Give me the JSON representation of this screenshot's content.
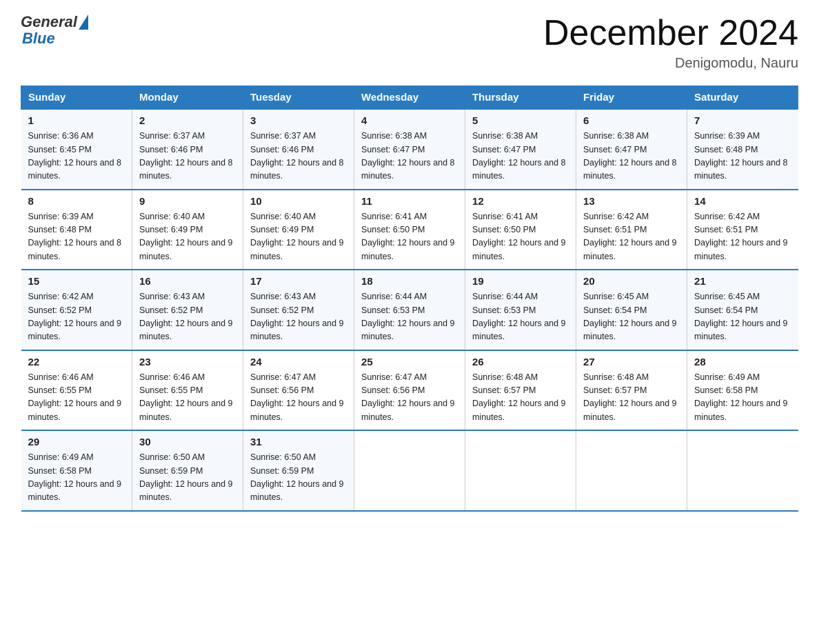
{
  "header": {
    "logo_general": "General",
    "logo_blue": "Blue",
    "month_year": "December 2024",
    "location": "Denigomodu, Nauru"
  },
  "columns": [
    "Sunday",
    "Monday",
    "Tuesday",
    "Wednesday",
    "Thursday",
    "Friday",
    "Saturday"
  ],
  "weeks": [
    [
      {
        "day": "1",
        "sunrise": "6:36 AM",
        "sunset": "6:45 PM",
        "daylight": "12 hours and 8 minutes."
      },
      {
        "day": "2",
        "sunrise": "6:37 AM",
        "sunset": "6:46 PM",
        "daylight": "12 hours and 8 minutes."
      },
      {
        "day": "3",
        "sunrise": "6:37 AM",
        "sunset": "6:46 PM",
        "daylight": "12 hours and 8 minutes."
      },
      {
        "day": "4",
        "sunrise": "6:38 AM",
        "sunset": "6:47 PM",
        "daylight": "12 hours and 8 minutes."
      },
      {
        "day": "5",
        "sunrise": "6:38 AM",
        "sunset": "6:47 PM",
        "daylight": "12 hours and 8 minutes."
      },
      {
        "day": "6",
        "sunrise": "6:38 AM",
        "sunset": "6:47 PM",
        "daylight": "12 hours and 8 minutes."
      },
      {
        "day": "7",
        "sunrise": "6:39 AM",
        "sunset": "6:48 PM",
        "daylight": "12 hours and 8 minutes."
      }
    ],
    [
      {
        "day": "8",
        "sunrise": "6:39 AM",
        "sunset": "6:48 PM",
        "daylight": "12 hours and 8 minutes."
      },
      {
        "day": "9",
        "sunrise": "6:40 AM",
        "sunset": "6:49 PM",
        "daylight": "12 hours and 9 minutes."
      },
      {
        "day": "10",
        "sunrise": "6:40 AM",
        "sunset": "6:49 PM",
        "daylight": "12 hours and 9 minutes."
      },
      {
        "day": "11",
        "sunrise": "6:41 AM",
        "sunset": "6:50 PM",
        "daylight": "12 hours and 9 minutes."
      },
      {
        "day": "12",
        "sunrise": "6:41 AM",
        "sunset": "6:50 PM",
        "daylight": "12 hours and 9 minutes."
      },
      {
        "day": "13",
        "sunrise": "6:42 AM",
        "sunset": "6:51 PM",
        "daylight": "12 hours and 9 minutes."
      },
      {
        "day": "14",
        "sunrise": "6:42 AM",
        "sunset": "6:51 PM",
        "daylight": "12 hours and 9 minutes."
      }
    ],
    [
      {
        "day": "15",
        "sunrise": "6:42 AM",
        "sunset": "6:52 PM",
        "daylight": "12 hours and 9 minutes."
      },
      {
        "day": "16",
        "sunrise": "6:43 AM",
        "sunset": "6:52 PM",
        "daylight": "12 hours and 9 minutes."
      },
      {
        "day": "17",
        "sunrise": "6:43 AM",
        "sunset": "6:52 PM",
        "daylight": "12 hours and 9 minutes."
      },
      {
        "day": "18",
        "sunrise": "6:44 AM",
        "sunset": "6:53 PM",
        "daylight": "12 hours and 9 minutes."
      },
      {
        "day": "19",
        "sunrise": "6:44 AM",
        "sunset": "6:53 PM",
        "daylight": "12 hours and 9 minutes."
      },
      {
        "day": "20",
        "sunrise": "6:45 AM",
        "sunset": "6:54 PM",
        "daylight": "12 hours and 9 minutes."
      },
      {
        "day": "21",
        "sunrise": "6:45 AM",
        "sunset": "6:54 PM",
        "daylight": "12 hours and 9 minutes."
      }
    ],
    [
      {
        "day": "22",
        "sunrise": "6:46 AM",
        "sunset": "6:55 PM",
        "daylight": "12 hours and 9 minutes."
      },
      {
        "day": "23",
        "sunrise": "6:46 AM",
        "sunset": "6:55 PM",
        "daylight": "12 hours and 9 minutes."
      },
      {
        "day": "24",
        "sunrise": "6:47 AM",
        "sunset": "6:56 PM",
        "daylight": "12 hours and 9 minutes."
      },
      {
        "day": "25",
        "sunrise": "6:47 AM",
        "sunset": "6:56 PM",
        "daylight": "12 hours and 9 minutes."
      },
      {
        "day": "26",
        "sunrise": "6:48 AM",
        "sunset": "6:57 PM",
        "daylight": "12 hours and 9 minutes."
      },
      {
        "day": "27",
        "sunrise": "6:48 AM",
        "sunset": "6:57 PM",
        "daylight": "12 hours and 9 minutes."
      },
      {
        "day": "28",
        "sunrise": "6:49 AM",
        "sunset": "6:58 PM",
        "daylight": "12 hours and 9 minutes."
      }
    ],
    [
      {
        "day": "29",
        "sunrise": "6:49 AM",
        "sunset": "6:58 PM",
        "daylight": "12 hours and 9 minutes."
      },
      {
        "day": "30",
        "sunrise": "6:50 AM",
        "sunset": "6:59 PM",
        "daylight": "12 hours and 9 minutes."
      },
      {
        "day": "31",
        "sunrise": "6:50 AM",
        "sunset": "6:59 PM",
        "daylight": "12 hours and 9 minutes."
      },
      null,
      null,
      null,
      null
    ]
  ]
}
